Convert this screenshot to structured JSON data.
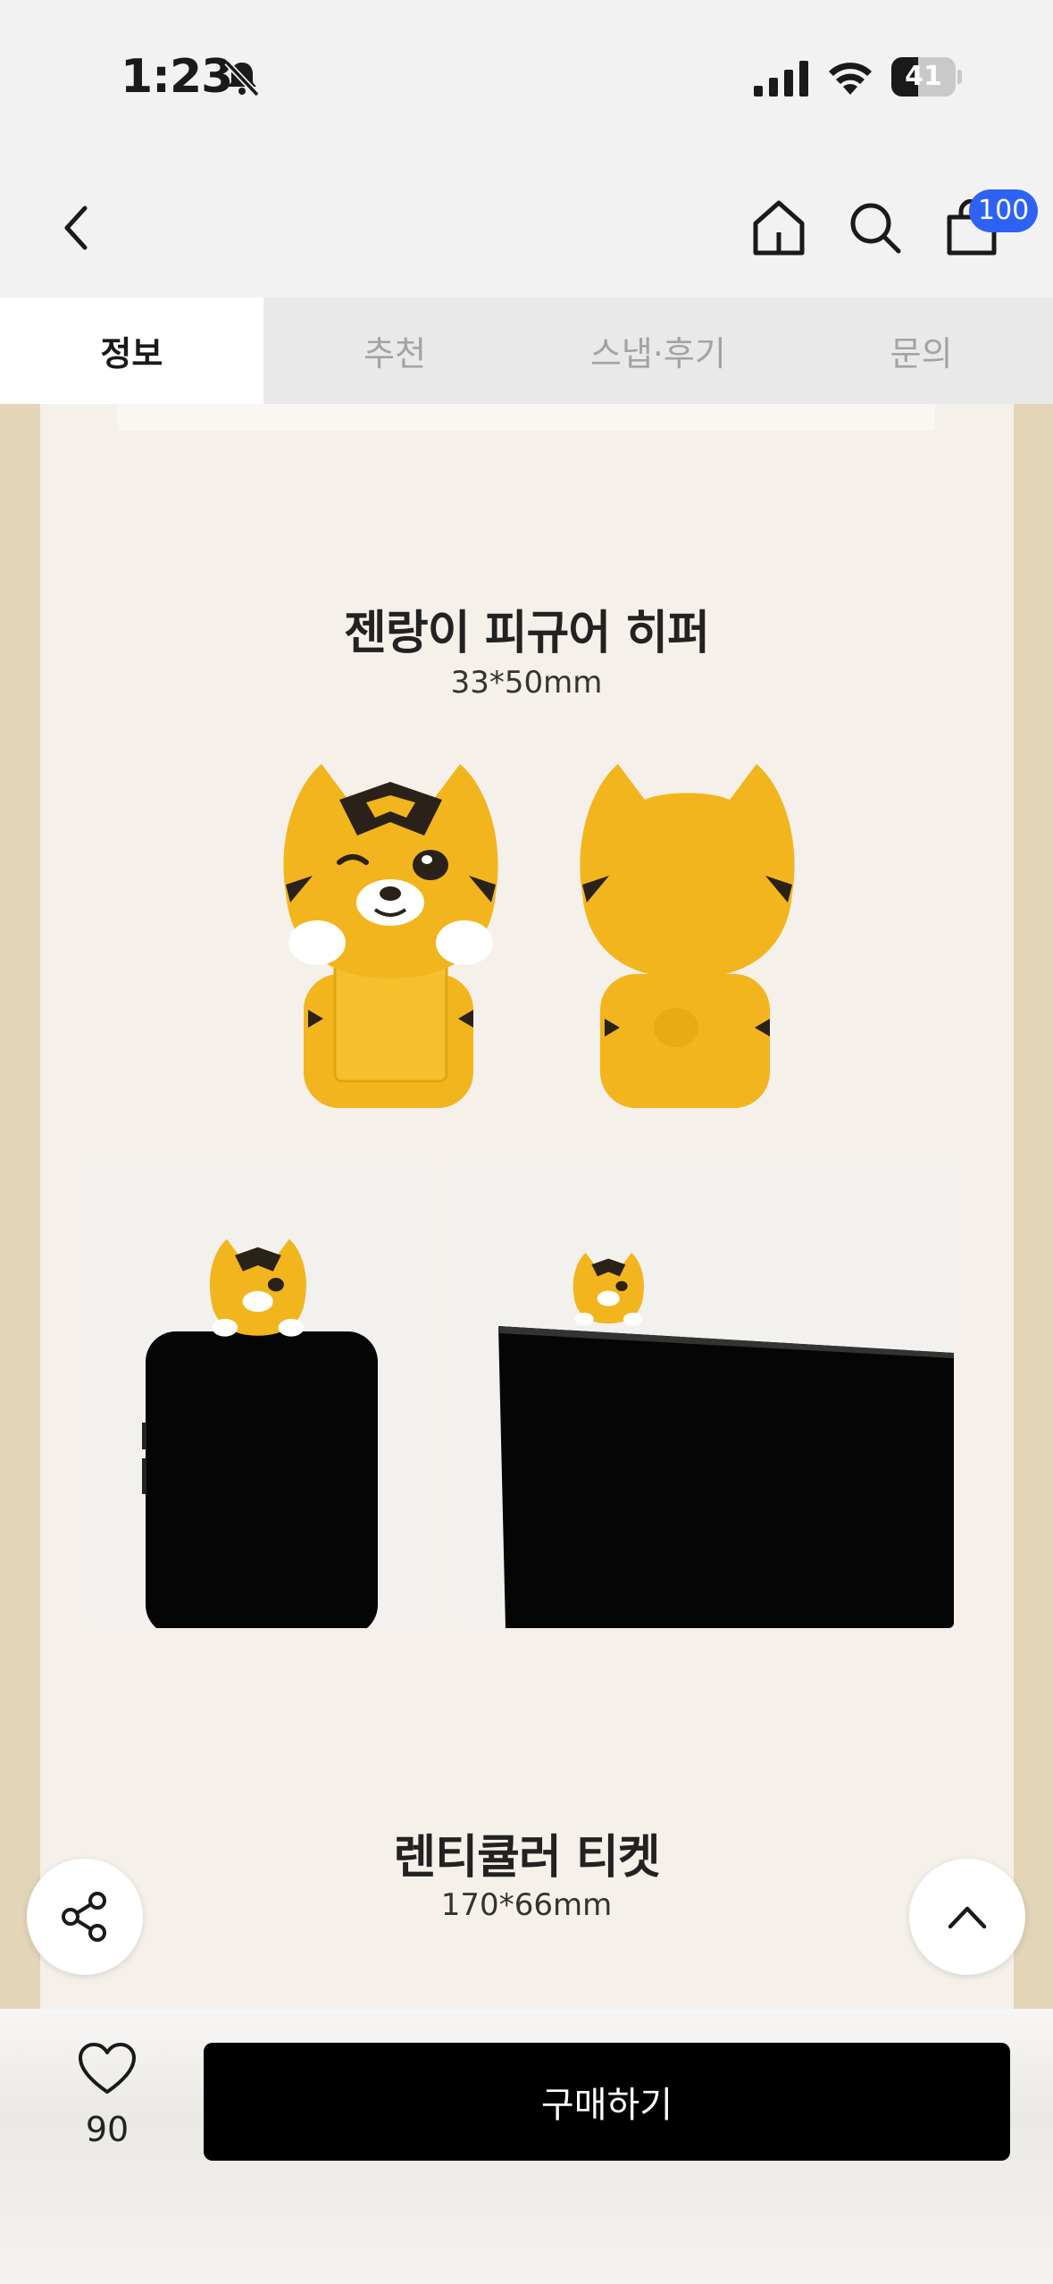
{
  "status_bar": {
    "time": "1:23",
    "battery_level": 41,
    "battery_label": "41",
    "icons": [
      "bell-slash-icon",
      "signal-icon",
      "wifi-icon",
      "battery-icon"
    ]
  },
  "nav": {
    "icons": [
      "chevron-left-icon",
      "home-icon",
      "search-icon",
      "shopping-bag-icon"
    ],
    "cart_count": "100"
  },
  "tabs": [
    {
      "label": "정보",
      "active": true
    },
    {
      "label": "추천",
      "active": false
    },
    {
      "label": "스냅·후기",
      "active": false
    },
    {
      "label": "문의",
      "active": false
    }
  ],
  "products": [
    {
      "title": "젠랑이 피규어 히퍼",
      "size": "33*50mm"
    },
    {
      "title": "렌티큘러 티켓",
      "size": "170*66mm"
    }
  ],
  "floating": {
    "icons": [
      "share-icon",
      "chevron-up-icon"
    ]
  },
  "bottom_bar": {
    "like_count": "90",
    "buy_label": "구매하기"
  },
  "colors": {
    "accent_badge": "#2d62f5",
    "figure_yellow": "#f2b51d",
    "page_side": "#e2d5b8",
    "content_bg": "#f5f0e9"
  }
}
